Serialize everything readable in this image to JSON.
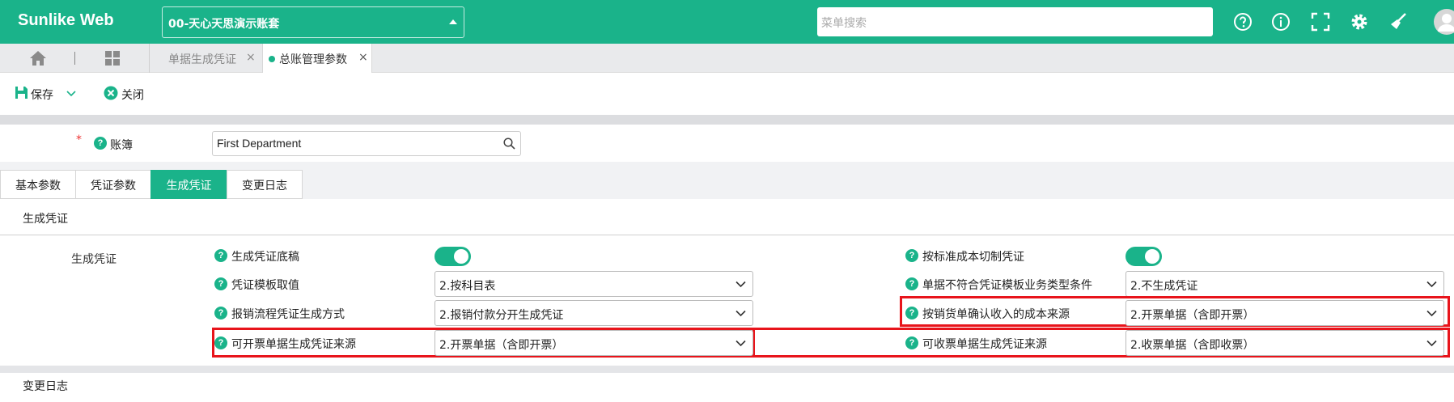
{
  "header": {
    "brand": "Sunlike Web",
    "account": "00-天心天思演示账套",
    "search_placeholder": "菜单搜索",
    "icons": [
      "help-circle-icon",
      "info-circle-icon",
      "fullscreen-icon",
      "gear-icon",
      "broom-icon",
      "user-avatar-icon"
    ]
  },
  "tabs": [
    {
      "label": "单据生成凭证",
      "close": "×",
      "active": false
    },
    {
      "label": "总账管理参数",
      "close": "×",
      "active": true
    }
  ],
  "toolbar": {
    "save_label": "保存",
    "close_label": "关闭"
  },
  "book": {
    "required_mark": "*",
    "help": "?",
    "label": "账簿",
    "value": "First Department"
  },
  "subtabs": [
    {
      "label": "基本参数",
      "active": false
    },
    {
      "label": "凭证参数",
      "active": false
    },
    {
      "label": "生成凭证",
      "active": true
    },
    {
      "label": "变更日志",
      "active": false
    }
  ],
  "section": {
    "header": "生成凭证",
    "group_label": "生成凭证",
    "left_fields": [
      {
        "label": "生成凭证底稿",
        "type": "toggle",
        "on": true
      },
      {
        "label": "凭证模板取值",
        "type": "select",
        "value": "2.按科目表"
      },
      {
        "label": "报销流程凭证生成方式",
        "type": "select",
        "value": "2.报销付款分开生成凭证"
      },
      {
        "label": "可开票单据生成凭证来源",
        "type": "select",
        "value": "2.开票单据（含即开票）",
        "highlighted": true
      }
    ],
    "right_fields": [
      {
        "label": "按标准成本切制凭证",
        "type": "toggle",
        "on": true
      },
      {
        "label": "单据不符合凭证模板业务类型条件",
        "type": "select",
        "value": "2.不生成凭证"
      },
      {
        "label": "按销货单确认收入的成本来源",
        "type": "select",
        "value": "2.开票单据（含即开票）",
        "highlighted": true
      },
      {
        "label": "可收票单据生成凭证来源",
        "type": "select",
        "value": "2.收票单据（含即收票）",
        "highlighted": true
      }
    ]
  },
  "footer_section": "变更日志",
  "colors": {
    "accent": "#1ab38a",
    "highlight": "#e8141b"
  }
}
